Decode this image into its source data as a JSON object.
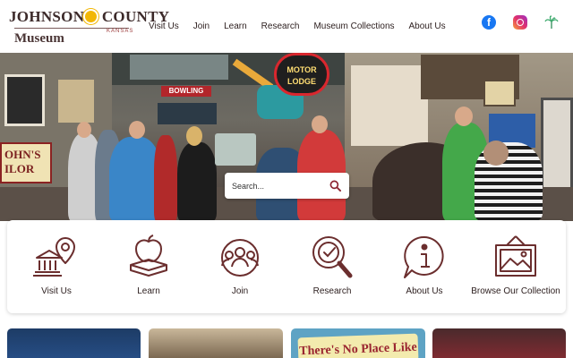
{
  "logo": {
    "line1_a": "JOHNSON",
    "line1_b": "COUNTY",
    "state": "KANSAS",
    "subtitle": "Museum"
  },
  "nav": {
    "items": [
      "Visit Us",
      "Join",
      "Learn",
      "Research",
      "Museum Collections",
      "About Us"
    ]
  },
  "social": {
    "facebook_glyph": "f",
    "icons": [
      "facebook-icon",
      "instagram-icon",
      "palm-icon"
    ]
  },
  "hero": {
    "sign_bowling": "BOWLING",
    "sign_motor_line1": "MOTOR",
    "sign_motor_line2": "LODGE",
    "sign_left": "OHN'S\nILOR"
  },
  "search": {
    "placeholder": "Search..."
  },
  "quick_links": [
    {
      "label": "Visit Us",
      "icon": "map-pin-museum-icon"
    },
    {
      "label": "Learn",
      "icon": "apple-books-icon"
    },
    {
      "label": "Join",
      "icon": "group-people-icon"
    },
    {
      "label": "Research",
      "icon": "magnifier-icon"
    },
    {
      "label": "About Us",
      "icon": "info-bubble-icon"
    },
    {
      "label": "Browse Our Collection",
      "icon": "framed-picture-icon"
    }
  ],
  "cards": {
    "card3_sign": "There's No Place Like"
  },
  "colors": {
    "icon_brown": "#6b2e2e",
    "text_dark": "#2b1d1d",
    "logo_sun": "#f2b705"
  }
}
